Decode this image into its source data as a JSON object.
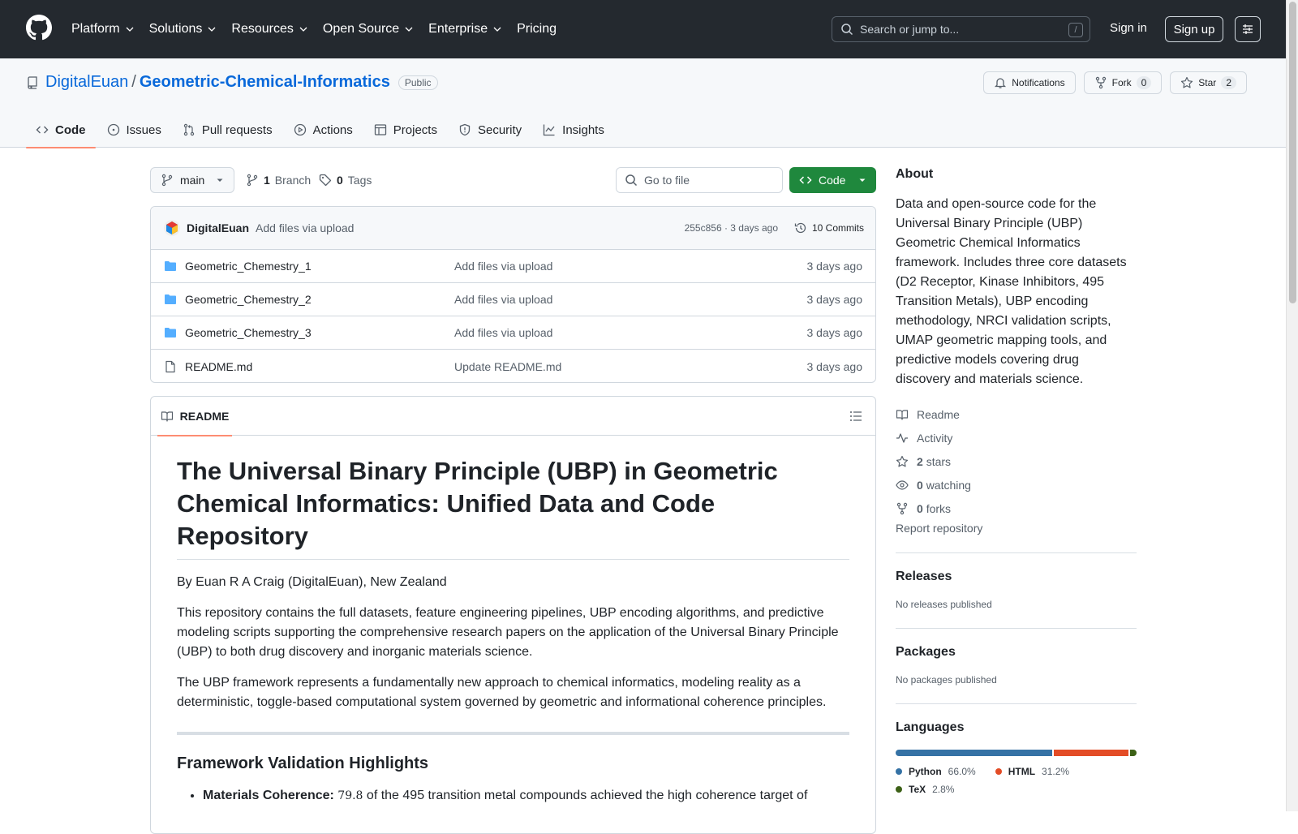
{
  "header": {
    "nav": [
      "Platform",
      "Solutions",
      "Resources",
      "Open Source",
      "Enterprise",
      "Pricing"
    ],
    "search_placeholder": "Search or jump to...",
    "search_key": "/",
    "sign_in": "Sign in",
    "sign_up": "Sign up"
  },
  "repo": {
    "owner": "DigitalEuan",
    "separator": "/",
    "name": "Geometric-Chemical-Informatics",
    "visibility": "Public",
    "notifications_label": "Notifications",
    "fork_label": "Fork",
    "fork_count": "0",
    "star_label": "Star",
    "star_count": "2",
    "tabs": [
      "Code",
      "Issues",
      "Pull requests",
      "Actions",
      "Projects",
      "Security",
      "Insights"
    ]
  },
  "toolbar": {
    "branch": "main",
    "branch_count": "1",
    "branch_label": "Branch",
    "tag_count": "0",
    "tag_label": "Tags",
    "goto_placeholder": "Go to file",
    "code_button": "Code"
  },
  "commit": {
    "author": "DigitalEuan",
    "message": "Add files via upload",
    "meta": "255c856 · 3 days ago",
    "commits_label": "10 Commits"
  },
  "files": [
    {
      "name": "Geometric_Chemestry_1",
      "message": "Add files via upload",
      "date": "3 days ago",
      "type": "folder"
    },
    {
      "name": "Geometric_Chemestry_2",
      "message": "Add files via upload",
      "date": "3 days ago",
      "type": "folder"
    },
    {
      "name": "Geometric_Chemestry_3",
      "message": "Add files via upload",
      "date": "3 days ago",
      "type": "folder"
    },
    {
      "name": "README.md",
      "message": "Update README.md",
      "date": "3 days ago",
      "type": "file"
    }
  ],
  "readme": {
    "tab_label": "README",
    "title": "The Universal Binary Principle (UBP) in Geometric Chemical Informatics: Unified Data and Code Repository",
    "byline": "By Euan R A Craig (DigitalEuan), New Zealand",
    "para1": "This repository contains the full datasets, feature engineering pipelines, UBP encoding algorithms, and predictive modeling scripts supporting the comprehensive research papers on the application of the Universal Binary Principle (UBP) to both drug discovery and inorganic materials science.",
    "para2": "The UBP framework represents a fundamentally new approach to chemical informatics, modeling reality as a deterministic, toggle-based computational system governed by geometric and informational coherence principles.",
    "h2": "Framework Validation Highlights",
    "bullet1_bold": "Materials Coherence:",
    "bullet1_mono": "79.8",
    "bullet1_rest": "of the 495 transition metal compounds achieved the high coherence target of"
  },
  "about": {
    "title": "About",
    "description": "Data and open-source code for the Universal Binary Principle (UBP) Geometric Chemical Informatics framework. Includes three core datasets (D2 Receptor, Kinase Inhibitors, 495 Transition Metals), UBP encoding methodology, NRCI validation scripts, UMAP geometric mapping tools, and predictive models covering drug discovery and materials science.",
    "readme": "Readme",
    "activity": "Activity",
    "stars_count": "2",
    "stars_label": "stars",
    "watching_count": "0",
    "watching_label": "watching",
    "forks_count": "0",
    "forks_label": "forks",
    "report": "Report repository"
  },
  "releases": {
    "title": "Releases",
    "text": "No releases published"
  },
  "packages": {
    "title": "Packages",
    "text": "No packages published"
  },
  "languages": {
    "title": "Languages",
    "items": [
      {
        "name": "Python",
        "percent": 66.0,
        "label": "66.0%",
        "color": "#3572A5"
      },
      {
        "name": "HTML",
        "percent": 31.2,
        "label": "31.2%",
        "color": "#e34c26"
      },
      {
        "name": "TeX",
        "percent": 2.8,
        "label": "2.8%",
        "color": "#3D6117"
      }
    ]
  }
}
